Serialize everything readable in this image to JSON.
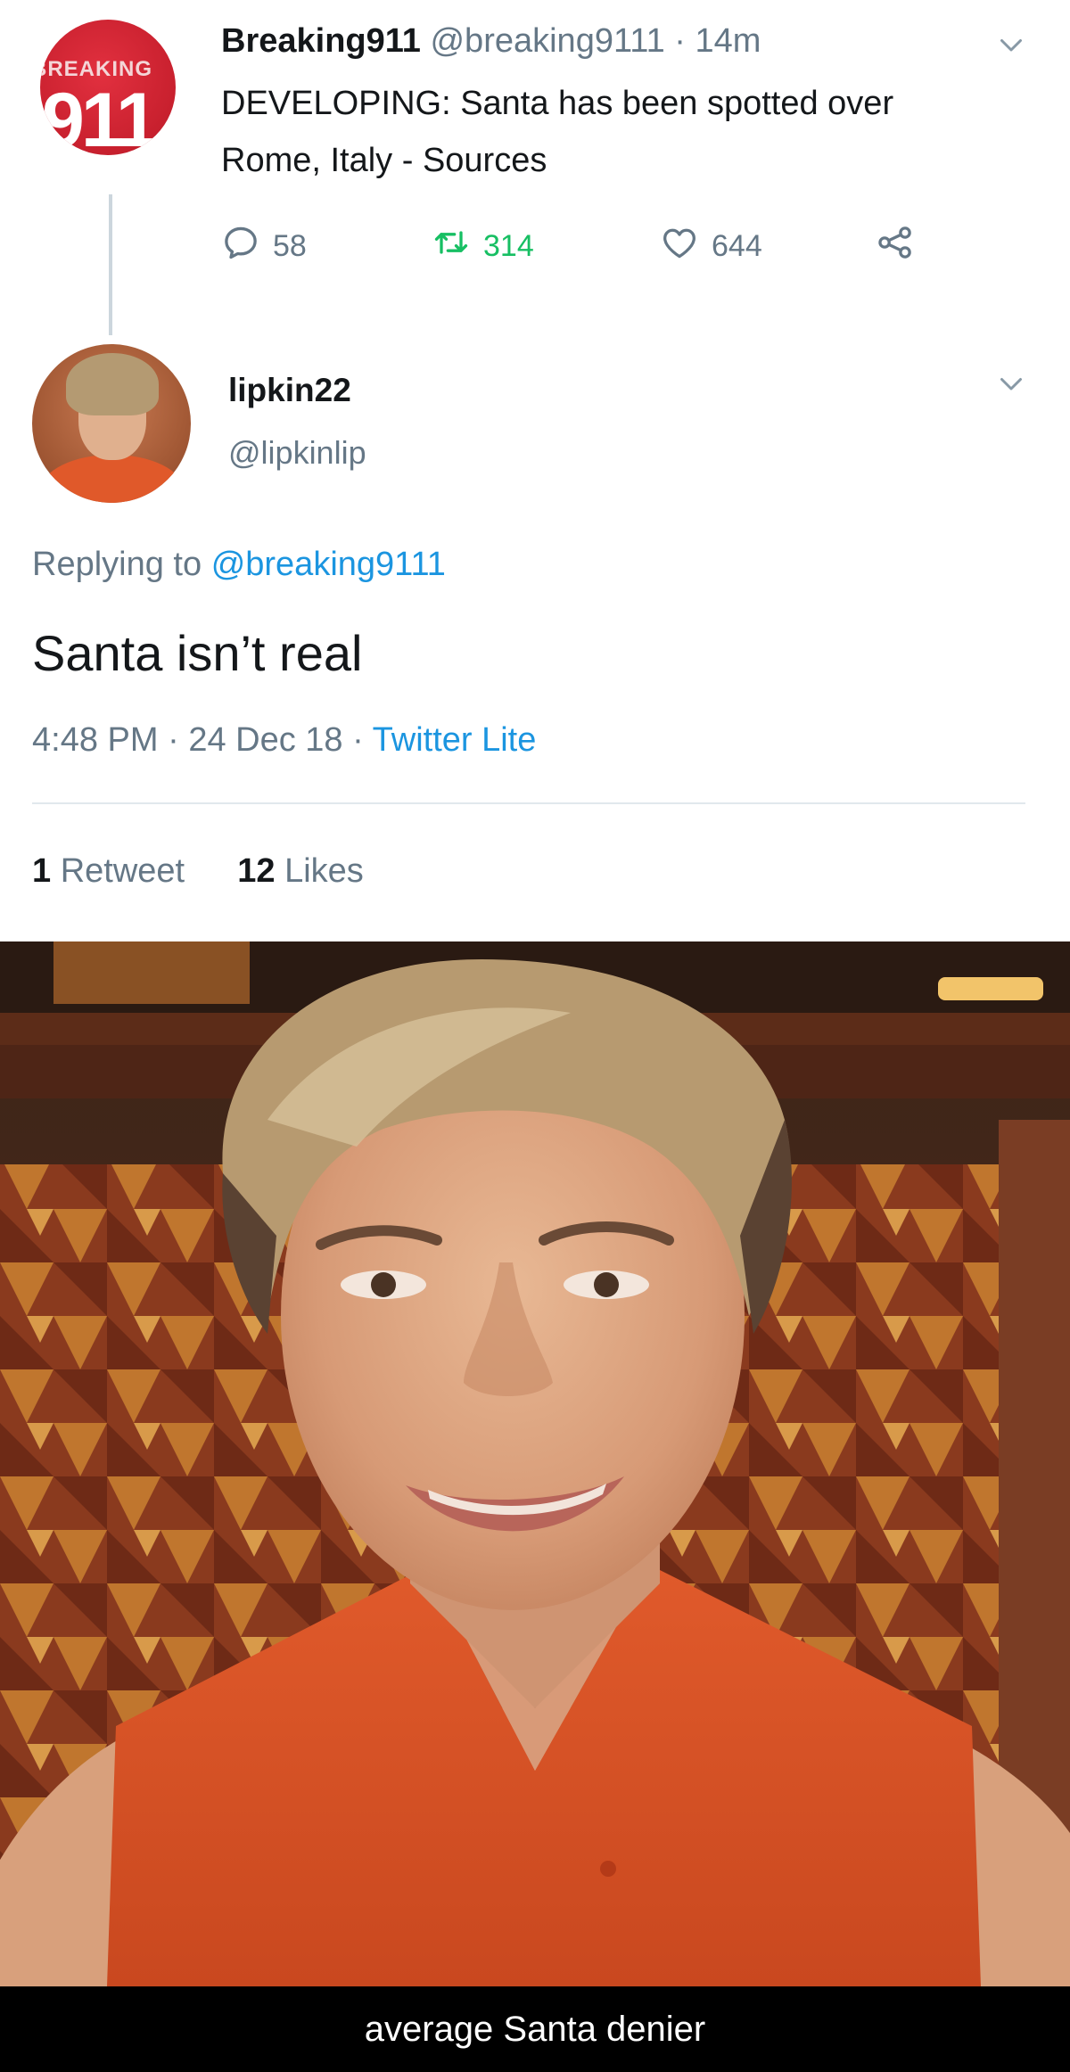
{
  "tweet1": {
    "avatar_band_text": "BREAKING",
    "avatar_number": "911",
    "name": "Breaking911",
    "handle": "@breaking9111",
    "separator": "·",
    "time": "14m",
    "text": "DEVELOPING: Santa has been spotted over Rome, Italy - Sources",
    "actions": {
      "replies": "58",
      "retweets": "314",
      "likes": "644"
    }
  },
  "tweet2": {
    "name": "lipkin22",
    "handle": "@lipkinlip",
    "replying_prefix": "Replying to",
    "replying_to": "@breaking9111",
    "text": "Santa isn’t real",
    "time": "4:48 PM",
    "separator": "·",
    "date": "24 Dec 18",
    "source": "Twitter Lite",
    "retweet_count": "1",
    "retweet_label": "Retweet",
    "like_count": "12",
    "like_label": "Likes"
  },
  "caption": "average Santa denier",
  "colors": {
    "text_primary": "#14171a",
    "text_secondary": "#657786",
    "link": "#1b95e0",
    "retweet_green": "#17bf63",
    "brand_red": "#c8202e"
  },
  "icons": {
    "reply": "reply-icon",
    "retweet": "retweet-icon",
    "like": "heart-icon",
    "share": "share-icon",
    "caret": "chevron-down-icon"
  }
}
